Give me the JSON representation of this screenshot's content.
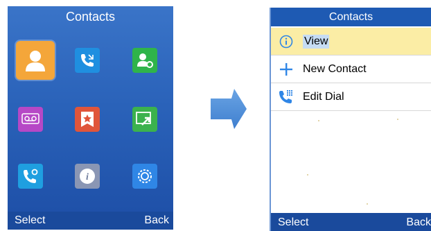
{
  "left_screen": {
    "title": "Contacts",
    "softkeys": {
      "left": "Select",
      "right": "Back"
    },
    "icons": [
      {
        "name": "contacts-icon",
        "color": "#f4a63a"
      },
      {
        "name": "call-history-icon",
        "color": "#1f8fe0"
      },
      {
        "name": "contact-settings-icon",
        "color": "#2fb44a"
      },
      {
        "name": "voicemail-icon",
        "color": "#b648c6"
      },
      {
        "name": "favorites-icon",
        "color": "#e0553a"
      },
      {
        "name": "transfer-icon",
        "color": "#3bb24d"
      },
      {
        "name": "call-settings-icon",
        "color": "#1f9fe0"
      },
      {
        "name": "info-icon",
        "color": "#8a96b4"
      },
      {
        "name": "system-settings-icon",
        "color": "#2f86e6"
      }
    ]
  },
  "right_screen": {
    "title": "Contacts",
    "menu": [
      {
        "label": "View",
        "icon": "info-icon",
        "selected": true
      },
      {
        "label": "New Contact",
        "icon": "plus-icon",
        "selected": false
      },
      {
        "label": "Edit Dial",
        "icon": "dialpad-icon",
        "selected": false
      }
    ],
    "softkeys": {
      "left": "Select",
      "right": "Back"
    }
  },
  "colors": {
    "screen_blue": "#2a62b9",
    "title_bar": "#1e5ab3",
    "selection": "#fbeda5",
    "arrow": "#4f8fd6"
  }
}
